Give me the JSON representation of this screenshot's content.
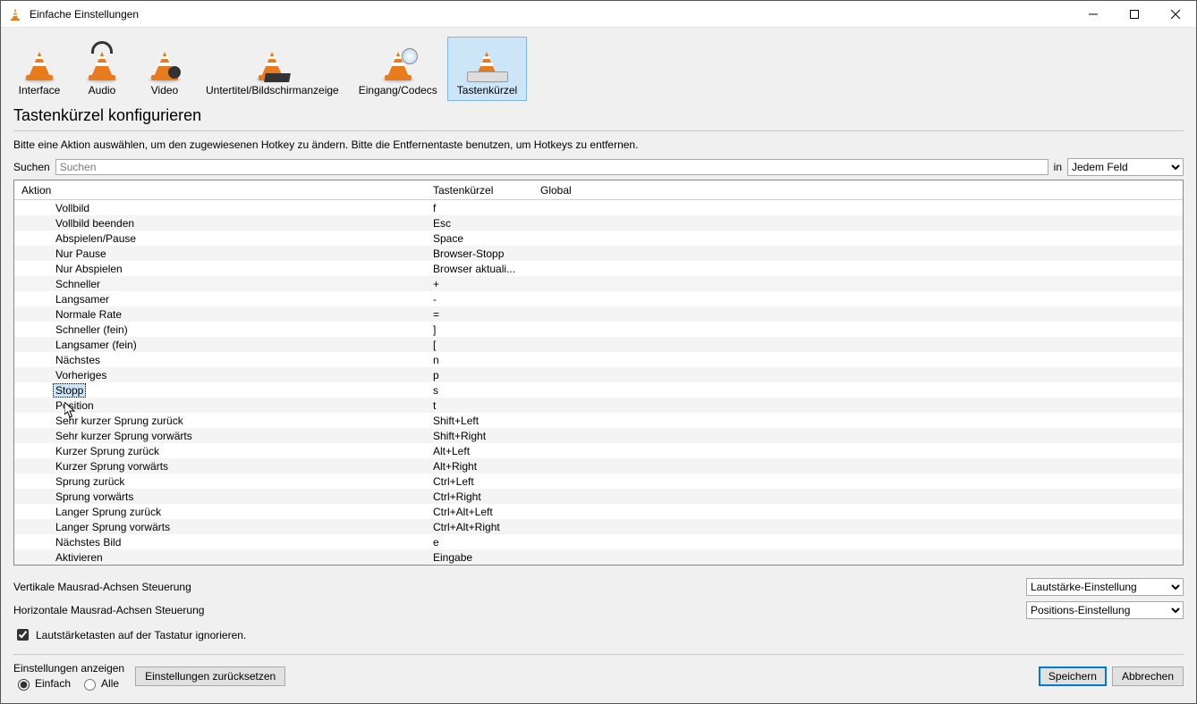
{
  "window": {
    "title": "Einfache Einstellungen"
  },
  "tabs": [
    {
      "label": "Interface"
    },
    {
      "label": "Audio"
    },
    {
      "label": "Video"
    },
    {
      "label": "Untertitel/Bildschirmanzeige"
    },
    {
      "label": "Eingang/Codecs"
    },
    {
      "label": "Tastenkürzel"
    }
  ],
  "section_title": "Tastenkürzel konfigurieren",
  "instructions": "Bitte eine Aktion auswählen, um den zugewiesenen Hotkey zu ändern. Bitte die Entfernentaste benutzen, um Hotkeys zu entfernen.",
  "search": {
    "label": "Suchen",
    "placeholder": "Suchen",
    "in_label": "in",
    "in_value": "Jedem Feld"
  },
  "columns": {
    "action": "Aktion",
    "hotkey": "Tastenkürzel",
    "global": "Global"
  },
  "rows": [
    {
      "action": "Vollbild",
      "hotkey": "f",
      "global": ""
    },
    {
      "action": "Vollbild beenden",
      "hotkey": "Esc",
      "global": ""
    },
    {
      "action": "Abspielen/Pause",
      "hotkey": "Space",
      "global": ""
    },
    {
      "action": "Nur Pause",
      "hotkey": "Browser-Stopp",
      "global": ""
    },
    {
      "action": "Nur Abspielen",
      "hotkey": "Browser aktuali...",
      "global": ""
    },
    {
      "action": "Schneller",
      "hotkey": "+",
      "global": ""
    },
    {
      "action": "Langsamer",
      "hotkey": "-",
      "global": ""
    },
    {
      "action": "Normale Rate",
      "hotkey": "=",
      "global": ""
    },
    {
      "action": "Schneller (fein)",
      "hotkey": "]",
      "global": ""
    },
    {
      "action": "Langsamer (fein)",
      "hotkey": "[",
      "global": ""
    },
    {
      "action": "Nächstes",
      "hotkey": "n",
      "global": ""
    },
    {
      "action": "Vorheriges",
      "hotkey": "p",
      "global": ""
    },
    {
      "action": "Stopp",
      "hotkey": "s",
      "global": "",
      "selected": true
    },
    {
      "action": "Position",
      "hotkey": "t",
      "global": ""
    },
    {
      "action": "Sehr kurzer Sprung zurück",
      "hotkey": "Shift+Left",
      "global": ""
    },
    {
      "action": "Sehr kurzer Sprung vorwärts",
      "hotkey": "Shift+Right",
      "global": ""
    },
    {
      "action": "Kurzer Sprung zurück",
      "hotkey": "Alt+Left",
      "global": ""
    },
    {
      "action": "Kurzer Sprung vorwärts",
      "hotkey": "Alt+Right",
      "global": ""
    },
    {
      "action": "Sprung zurück",
      "hotkey": "Ctrl+Left",
      "global": ""
    },
    {
      "action": "Sprung vorwärts",
      "hotkey": "Ctrl+Right",
      "global": ""
    },
    {
      "action": "Langer Sprung zurück",
      "hotkey": "Ctrl+Alt+Left",
      "global": ""
    },
    {
      "action": "Langer Sprung vorwärts",
      "hotkey": "Ctrl+Alt+Right",
      "global": ""
    },
    {
      "action": "Nächstes Bild",
      "hotkey": "e",
      "global": ""
    },
    {
      "action": "Aktivieren",
      "hotkey": "Eingabe",
      "global": ""
    }
  ],
  "vertical_axis": {
    "label": "Vertikale Mausrad-Achsen Steuerung",
    "value": "Lautstärke-Einstellung"
  },
  "horizontal_axis": {
    "label": "Horizontale Mausrad-Achsen Steuerung",
    "value": "Positions-Einstellung"
  },
  "ignore_volume": {
    "label": "Lautstärketasten auf der Tastatur ignorieren.",
    "checked": true
  },
  "show_settings": {
    "title": "Einstellungen anzeigen",
    "simple": "Einfach",
    "all": "Alle"
  },
  "reset_button": "Einstellungen zurücksetzen",
  "save_button": "Speichern",
  "cancel_button": "Abbrechen"
}
